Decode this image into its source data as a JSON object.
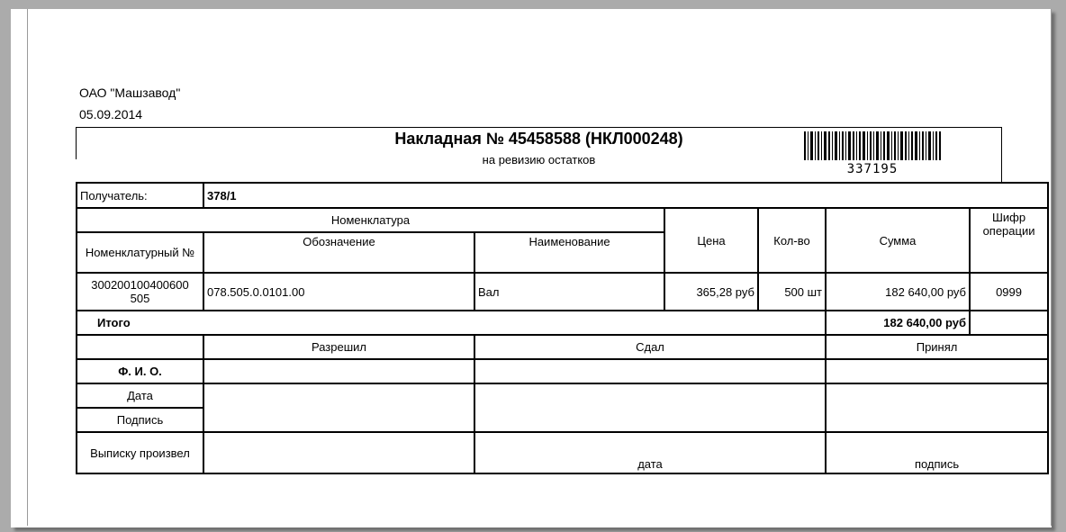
{
  "organization": "ОАО \"Машзавод\"",
  "document_date": "05.09.2014",
  "title": "Накладная № 45458588 (НКЛ000248)",
  "subtitle": "на ревизию остатков",
  "barcode": {
    "icon": "barcode-icon",
    "number": "337195"
  },
  "recipient": {
    "label": "Получатель:",
    "value": "378/1"
  },
  "columns": {
    "nomenclature_group": "Номенклатура",
    "nomenclature_no": "Номенклатурный №",
    "designation": "Обозначение",
    "name": "Наименование",
    "price": "Цена",
    "qty": "Кол-во",
    "sum": "Сумма",
    "op_code": "Шифр операции"
  },
  "rows": [
    {
      "nomenclature_no": "300200100400600 505",
      "designation": "078.505.0.0101.00",
      "name": "Вал",
      "price": "365,28 руб",
      "qty": "500 шт",
      "sum": "182 640,00 руб",
      "op_code": "0999"
    }
  ],
  "total": {
    "label": "Итого",
    "value": "182 640,00 руб"
  },
  "signatures": {
    "allowed": "Разрешил",
    "handed": "Сдал",
    "received": "Принял",
    "fio": "Ф. И. О.",
    "date": "Дата",
    "sign": "Подпись",
    "extract_made": "Выписку произвел",
    "date_caption": "дата",
    "sign_caption": "подпись"
  }
}
